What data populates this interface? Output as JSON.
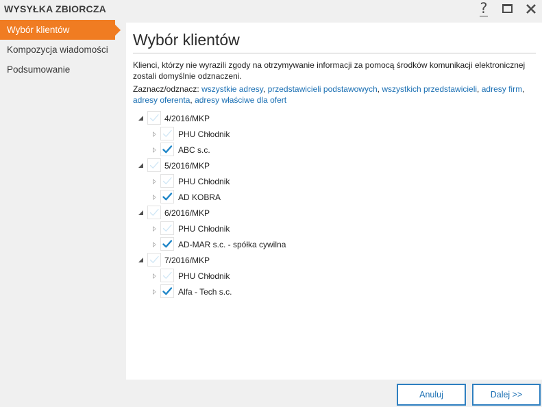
{
  "window": {
    "title": "WYSYŁKA ZBIORCZA",
    "help_glyph": "?",
    "controls": [
      "help-icon",
      "maximize-icon",
      "close-icon"
    ]
  },
  "sidebar": {
    "items": [
      {
        "label": "Wybór klientów",
        "active": true
      },
      {
        "label": "Kompozycja wiadomości",
        "active": false
      },
      {
        "label": "Podsumowanie",
        "active": false
      }
    ]
  },
  "main": {
    "title": "Wybór klientów",
    "intro": "Klienci, którzy nie wyrazili zgody na otrzymywanie informacji za pomocą środków komunikacji elektronicznej zostali domyślnie odznaczeni.",
    "select_prefix": "Zaznacz/odznacz:",
    "select_links": [
      "wszystkie adresy",
      "przedstawicieli podstawowych",
      "wszystkich przedstawicieli",
      "adresy firm",
      "adresy oferenta",
      "adresy właściwe dla ofert"
    ],
    "separator": ","
  },
  "tree": {
    "groups": [
      {
        "label": "4/2016/MKP",
        "expanded": true,
        "checked": "partial",
        "children": [
          {
            "label": "PHU Chłodnik",
            "checked": false
          },
          {
            "label": "ABC s.c.",
            "checked": true
          }
        ]
      },
      {
        "label": "5/2016/MKP",
        "expanded": true,
        "checked": "partial",
        "children": [
          {
            "label": "PHU Chłodnik",
            "checked": false
          },
          {
            "label": "AD KOBRA",
            "checked": true
          }
        ]
      },
      {
        "label": "6/2016/MKP",
        "expanded": true,
        "checked": "partial",
        "children": [
          {
            "label": "PHU Chłodnik",
            "checked": false
          },
          {
            "label": "AD-MAR s.c. - spółka cywilna",
            "checked": true
          }
        ]
      },
      {
        "label": "7/2016/MKP",
        "expanded": true,
        "checked": "partial",
        "children": [
          {
            "label": "PHU Chłodnik",
            "checked": false
          },
          {
            "label": "Alfa - Tech s.c.",
            "checked": true
          }
        ]
      }
    ]
  },
  "footer": {
    "cancel_label": "Anuluj",
    "next_label": "Dalej >>"
  },
  "colors": {
    "accent": "#f07c22",
    "link": "#1a6fb3",
    "button_border": "#2e7fc0",
    "check_on": "#1f86c8",
    "check_off": "#cfe6f5"
  }
}
